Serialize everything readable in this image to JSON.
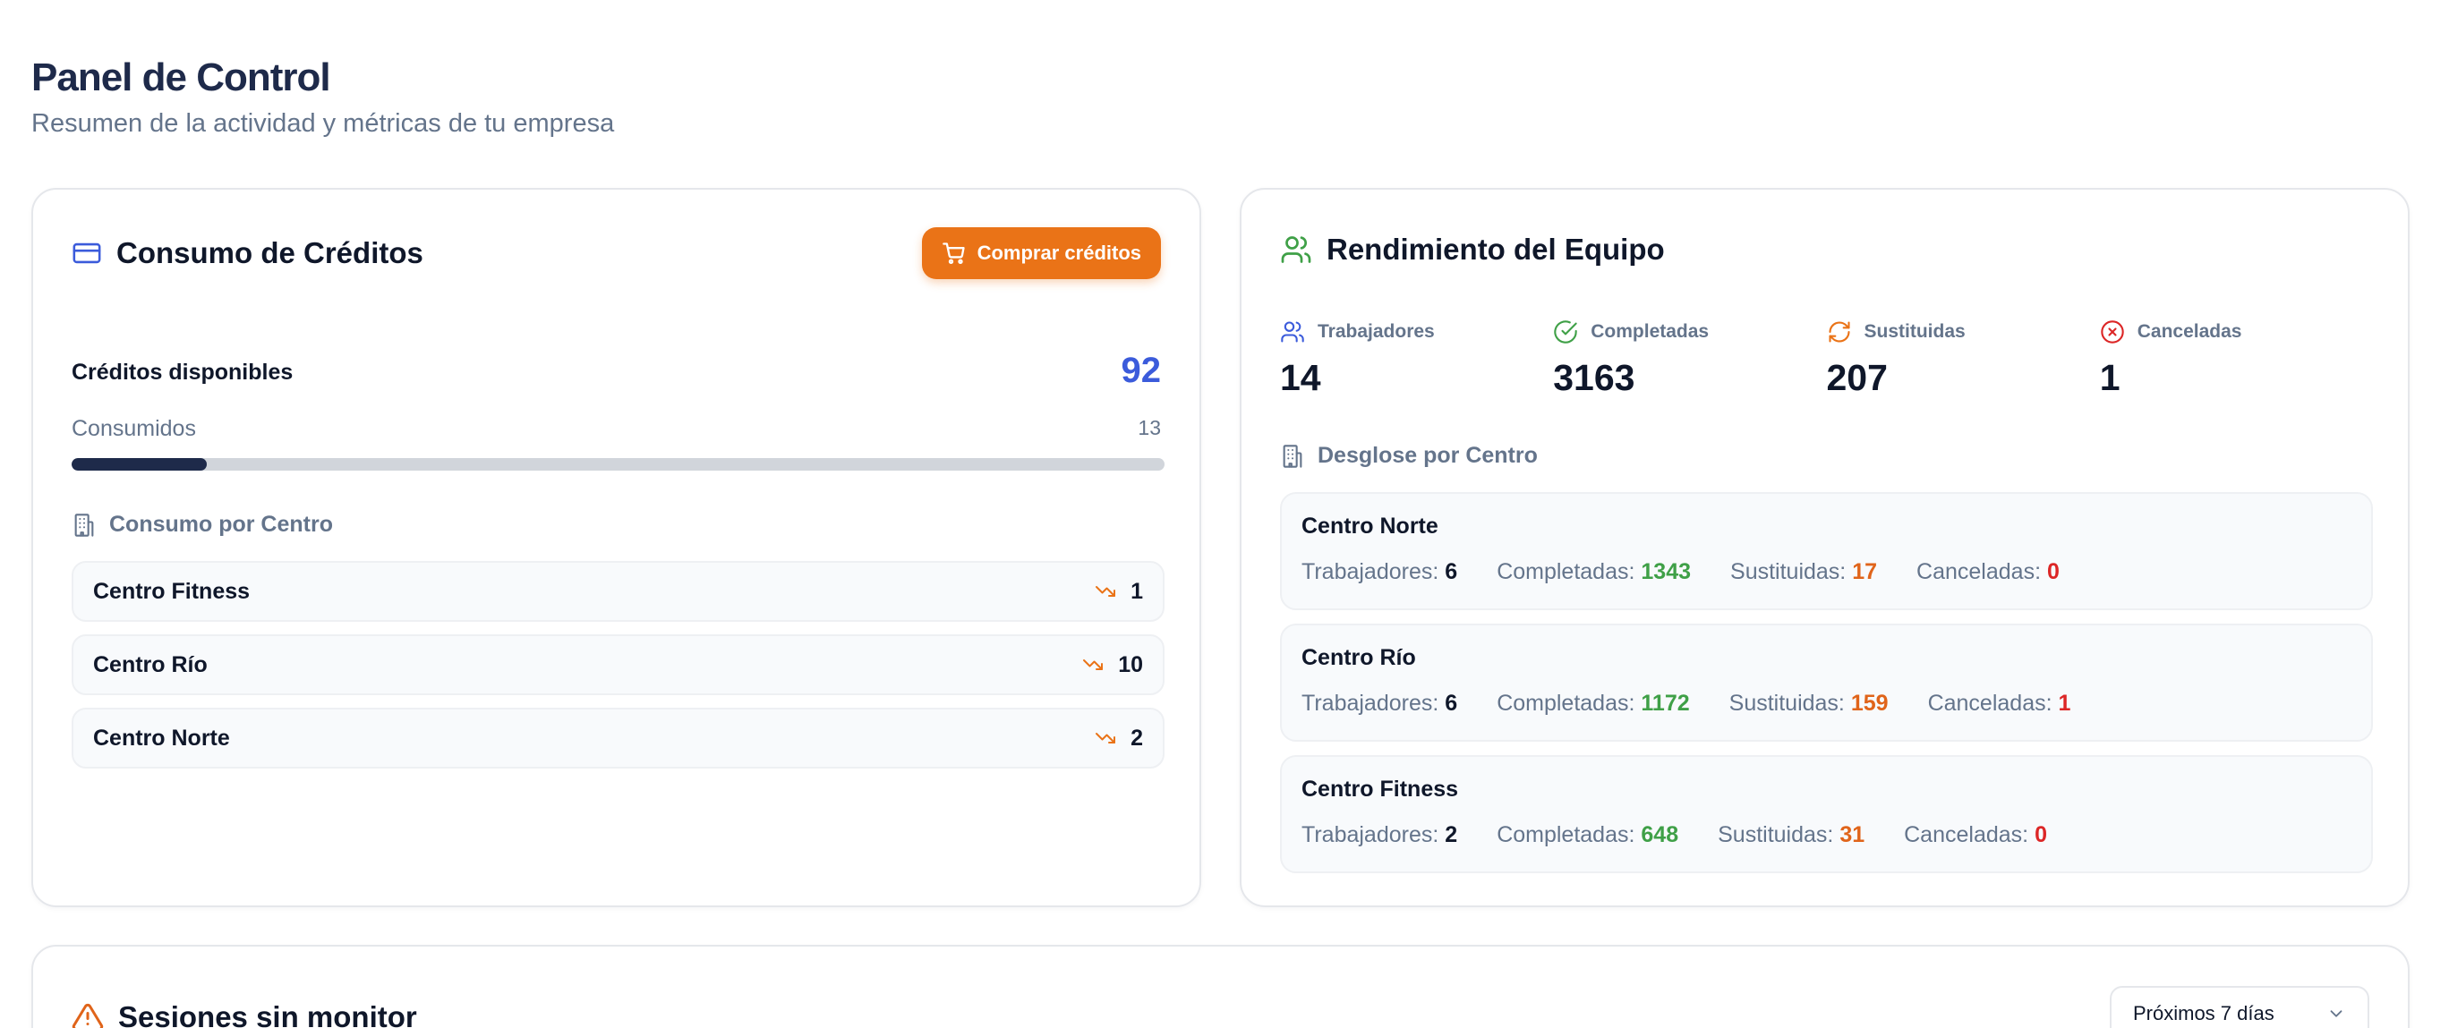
{
  "page": {
    "title": "Panel de Control",
    "subtitle": "Resumen de la actividad y métricas de tu empresa"
  },
  "credits": {
    "title": "Consumo de Créditos",
    "buy_label": "Comprar créditos",
    "available_label": "Créditos disponibles",
    "available_value": "92",
    "consumed_label": "Consumidos",
    "consumed_value": "13",
    "consumed_fraction": 0.124,
    "by_center_label": "Consumo por Centro",
    "centers": [
      {
        "name": "Centro Fitness",
        "value": "1"
      },
      {
        "name": "Centro Río",
        "value": "10"
      },
      {
        "name": "Centro Norte",
        "value": "2"
      }
    ]
  },
  "team": {
    "title": "Rendimiento del Equipo",
    "stats": [
      {
        "label": "Trabajadores",
        "value": "14",
        "icon": "users-icon"
      },
      {
        "label": "Completadas",
        "value": "3163",
        "icon": "check-circle-icon"
      },
      {
        "label": "Sustituidas",
        "value": "207",
        "icon": "refresh-icon"
      },
      {
        "label": "Canceladas",
        "value": "1",
        "icon": "x-circle-icon"
      }
    ],
    "breakdown_label": "Desglose por Centro",
    "labels": {
      "workers": "Trabajadores:",
      "completed": "Completadas:",
      "substituted": "Sustituidas:",
      "cancelled": "Canceladas:"
    },
    "breakdown": [
      {
        "name": "Centro Norte",
        "workers": "6",
        "completed": "1343",
        "substituted": "17",
        "cancelled": "0"
      },
      {
        "name": "Centro Río",
        "workers": "6",
        "completed": "1172",
        "substituted": "159",
        "cancelled": "1"
      },
      {
        "name": "Centro Fitness",
        "workers": "2",
        "completed": "648",
        "substituted": "31",
        "cancelled": "0"
      }
    ]
  },
  "sessions": {
    "title": "Sesiones sin monitor",
    "range_value": "Próximos 7 días"
  },
  "colors": {
    "accent_blue": "#3b5bdb",
    "brand_orange": "#ea7317",
    "success_green": "#3fa047",
    "warning_orange": "#e0641a",
    "danger_red": "#dc2626"
  }
}
